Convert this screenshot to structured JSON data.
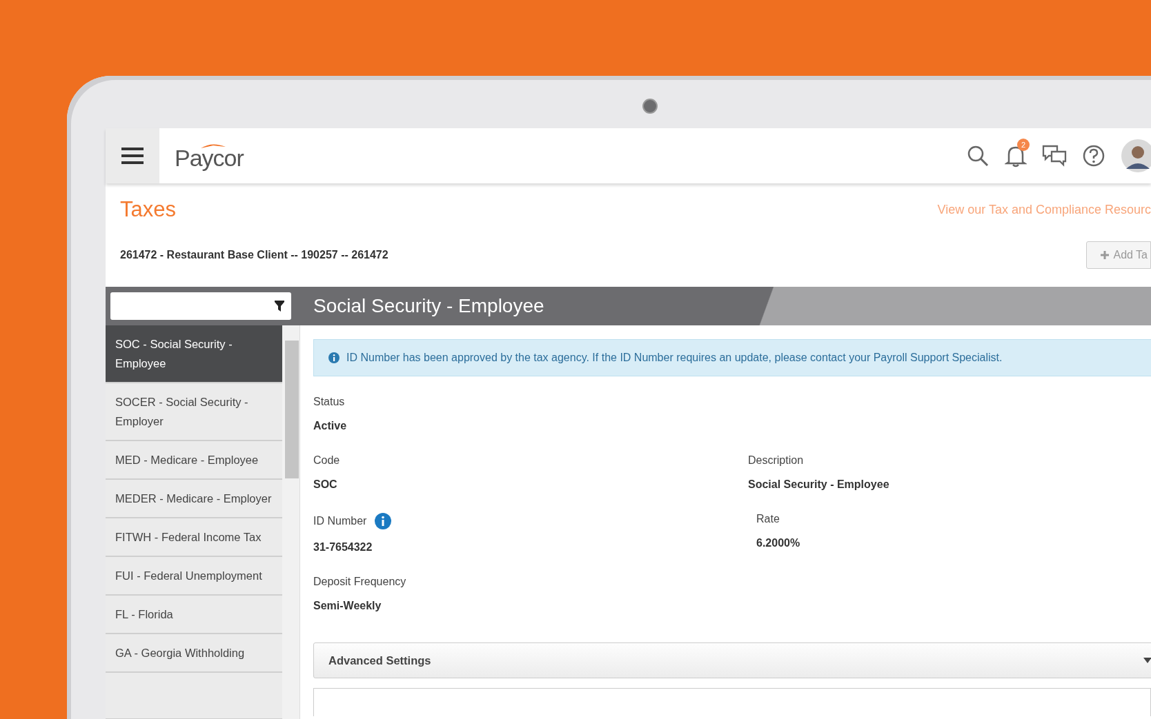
{
  "header": {
    "logo": "Paycor",
    "notifications": "2"
  },
  "page": {
    "title": "Taxes",
    "resource_link": "View our Tax and Compliance Resourc",
    "client": "261472 - Restaurant Base Client -- 190257 -- 261472",
    "add_button": "Add Ta"
  },
  "detail_title": "Social Security - Employee",
  "sidebar": {
    "items": [
      {
        "label": "SOC - Social Security - Employee",
        "selected": true
      },
      {
        "label": "SOCER - Social Security - Employer",
        "selected": false
      },
      {
        "label": "MED - Medicare - Employee",
        "selected": false
      },
      {
        "label": "MEDER - Medicare - Employer",
        "selected": false
      },
      {
        "label": "FITWH - Federal Income Tax",
        "selected": false
      },
      {
        "label": "FUI - Federal Unemployment",
        "selected": false
      },
      {
        "label": "FL - Florida",
        "selected": false
      },
      {
        "label": "GA - Georgia Withholding",
        "selected": false
      }
    ]
  },
  "notice": "ID Number has been approved by the tax agency. If the ID Number requires an update, please contact your Payroll Support Specialist.",
  "fields": [
    {
      "label": "Status",
      "value": "Active"
    },
    {
      "label": "Code",
      "value": "SOC"
    },
    {
      "label": "Description",
      "value": "Social Security - Employee"
    },
    {
      "label": "ID Number",
      "value": "31-7654322",
      "info": true
    },
    {
      "label": "Rate",
      "value": "6.2000%"
    },
    {
      "label": "Deposit Frequency",
      "value": "Semi-Weekly"
    }
  ],
  "advanced": {
    "label": "Advanced Settings",
    "expanded": false
  }
}
